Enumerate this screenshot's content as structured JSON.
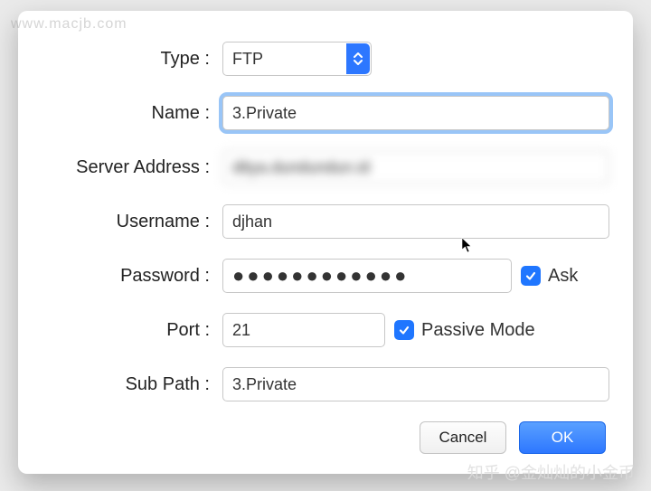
{
  "watermarks": {
    "top_left": "www.macjb.com",
    "bottom_right": "知乎 @金灿灿的小金币"
  },
  "form": {
    "labels": {
      "type": "Type :",
      "name": "Name :",
      "server_address": "Server Address :",
      "username": "Username :",
      "password": "Password :",
      "port": "Port :",
      "sub_path": "Sub Path :"
    },
    "values": {
      "type": "FTP",
      "name": "3.Private",
      "server_address": "ditya.dundundun.id",
      "username": "djhan",
      "password_masked": "●●●●●●●●●●●●",
      "port": "21",
      "sub_path": "3.Private"
    },
    "checkboxes": {
      "ask": {
        "checked": true,
        "label": "Ask"
      },
      "passive_mode": {
        "checked": true,
        "label": "Passive Mode"
      }
    }
  },
  "buttons": {
    "cancel": "Cancel",
    "ok": "OK"
  }
}
